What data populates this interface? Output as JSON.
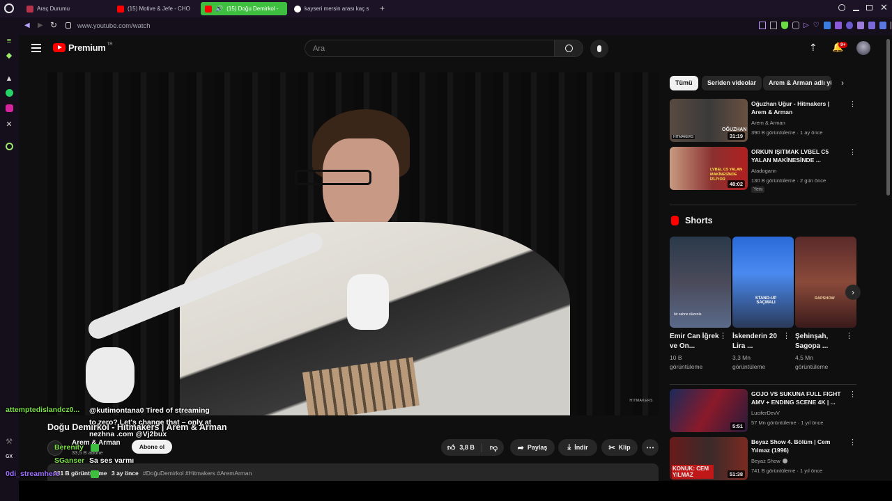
{
  "browser": {
    "tabs": [
      {
        "title": "Araç Durumu",
        "active": false
      },
      {
        "title": "(15) Motive & Jefe - CHO",
        "active": false
      },
      {
        "title": "(15) Doğu Demirkol -",
        "active": true
      },
      {
        "title": "kayseri mersin arası kaç s",
        "active": false
      }
    ],
    "new_tab_label": "+",
    "url": "www.youtube.com/watch",
    "sidebar_label_gx": "GX"
  },
  "youtube": {
    "logo_text": "Premium",
    "logo_tm": "TR",
    "search_placeholder": "Ara",
    "notification_count": "9+",
    "video": {
      "title": "Doğu Demirkol - Hitmakers | Arem & Arman",
      "channel": "Arem & Arman",
      "subscribers": "33,5 B abone",
      "subscribe_label": "Abone ol",
      "likes": "3,8 B",
      "share_label": "Paylaş",
      "download_label": "İndir",
      "clip_label": "Klip",
      "views": "281 B görüntüleme",
      "age": "3 ay önce",
      "hashtags": "#DoğuDemirkol #Hitmakers #AremArman",
      "watermark": "HITMAKERS"
    },
    "filter_chips": [
      "Tümü",
      "Seriden videolar",
      "Arem & Arman adlı yü"
    ],
    "recommendations": [
      {
        "title": "Oğuzhan Uğur - Hitmakers | Arem & Arman",
        "channel": "Arem & Arman",
        "meta": "390 B görüntüleme · 1 ay önce",
        "duration": "31:19",
        "thumb_text": "OĞUZHAN",
        "thumb_tag": "HITMAKERS",
        "badge": ""
      },
      {
        "title": "ORKUN IŞITMAK LVBEL C5 YALAN MAKİNESİNDE ...",
        "channel": "Atadogann",
        "meta": "130 B görüntüleme · 2 gün önce",
        "duration": "48:02",
        "thumb_text": "LVBEL C5 YALAN MAKİNESİNDE İZLİYOR",
        "thumb_tag": "",
        "badge": "Yeni"
      }
    ],
    "shorts": {
      "heading": "Shorts",
      "items": [
        {
          "title": "Emir Can İğrek ve On...",
          "views_line1": "10 B",
          "views_line2": "görüntüleme",
          "caption": "bir sahne düzenle"
        },
        {
          "title": "İskenderin 20 Lira ...",
          "views_line1": "3,3 Mn",
          "views_line2": "görüntüleme",
          "caption": "STAND-UP SAÇMALI"
        },
        {
          "title": "Şehinşah, Sagopa ...",
          "views_line1": "4,5 Mn",
          "views_line2": "görüntüleme",
          "caption": "RAPSHOW"
        }
      ]
    },
    "recommendations_lower": [
      {
        "title": "GOJO VS SUKUNA FULL FIGHT AMV + ENDING SCENE 4K | ...",
        "channel": "LuciferDevV",
        "meta": "57 Mn görüntüleme · 1 yıl önce",
        "duration": "5:51",
        "thumb_text": "",
        "thumb_tag": "",
        "badge": ""
      },
      {
        "title": "Beyaz Show 4. Bölüm | Cem Yılmaz (1996)",
        "channel": "Beyaz Show",
        "meta": "741 B görüntüleme · 1 yıl önce",
        "duration": "51:38",
        "thumb_text": "KONUK: CEM YILMAZ",
        "thumb_tag": "",
        "badge": ""
      }
    ]
  },
  "chat_overlay": [
    {
      "user": "attemptedislandcz0...",
      "message": "",
      "user_color": "#7ee04a"
    },
    {
      "user": "",
      "message": "@kutimontana0 Tired of streaming",
      "user_color": "#ffffff"
    },
    {
      "user": "",
      "message": "to zero? Let's change that – only at",
      "user_color": "#ffffff"
    },
    {
      "user": "",
      "message": "nezhna .com @Vj2bux",
      "user_color": "#ffffff"
    },
    {
      "user": "Berenity",
      "message": "",
      "user_color": "#7ee04a"
    },
    {
      "user": "SGanser",
      "message": "Sa ses varmı",
      "user_color": "#7ee04a"
    },
    {
      "user": "0di_streamhere",
      "message": "",
      "user_color": "#a070ff"
    }
  ],
  "colors": {
    "youtube_red": "#ff0000",
    "opera_tab_active": "#3fbf3f",
    "chat_user_green": "#7ee04a"
  }
}
